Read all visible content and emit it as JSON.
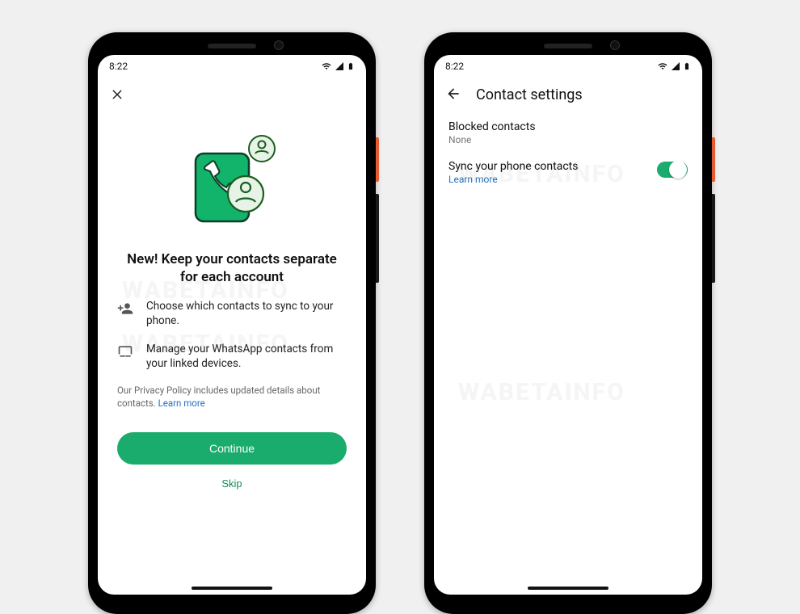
{
  "left": {
    "status_time": "8:22",
    "close_icon": "close",
    "title": "New! Keep your contacts separate for each account",
    "feature1": "Choose which contacts to sync to your phone.",
    "feature2": "Manage your WhatsApp contacts from your linked devices.",
    "privacy_prefix": "Our Privacy Policy includes updated details about contacts. ",
    "privacy_link": "Learn more",
    "continue_label": "Continue",
    "skip_label": "Skip"
  },
  "right": {
    "status_time": "8:22",
    "header_title": "Contact settings",
    "blocked_label": "Blocked contacts",
    "blocked_value": "None",
    "sync_label": "Sync your phone contacts",
    "sync_learn_more": "Learn more",
    "sync_toggle_on": true
  },
  "colors": {
    "primary_green": "#1aac6d",
    "link_blue": "#2472bd"
  }
}
